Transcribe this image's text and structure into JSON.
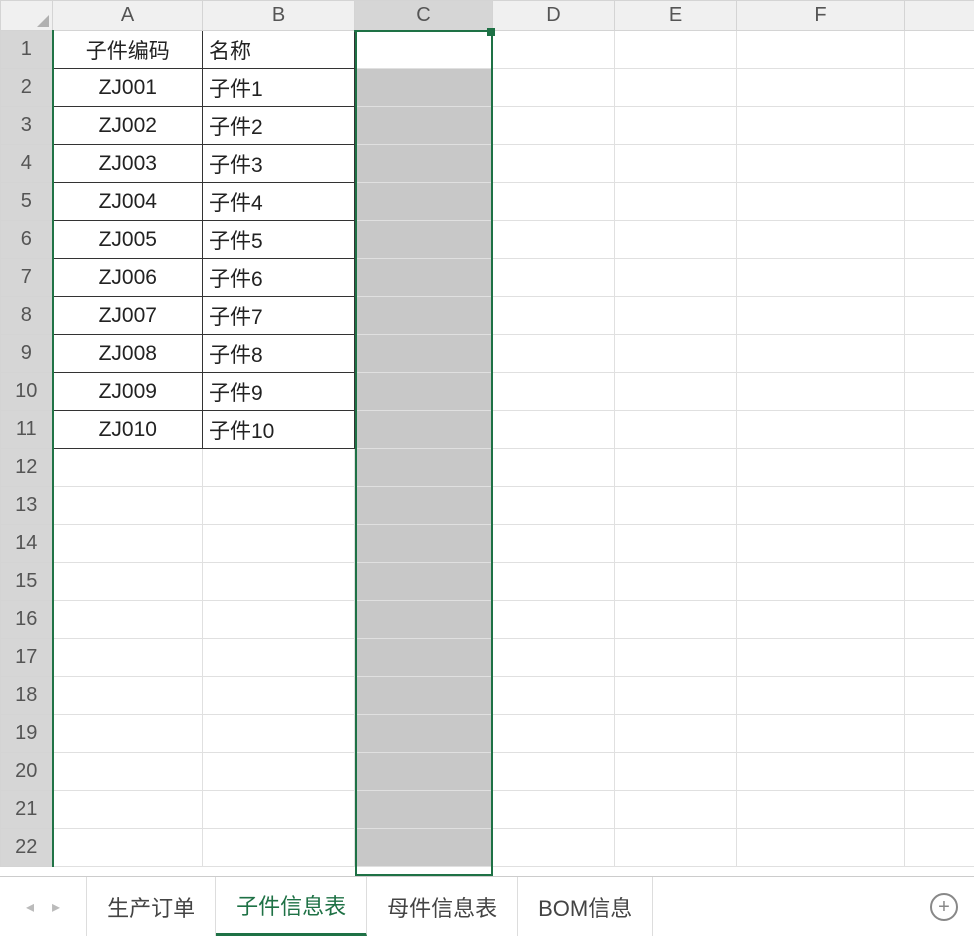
{
  "columns": [
    "A",
    "B",
    "C",
    "D",
    "E",
    "F"
  ],
  "selected_column": "C",
  "row_count": 22,
  "headers": {
    "A": "子件编码",
    "B": "名称"
  },
  "rows": [
    {
      "A": "ZJ001",
      "B": "子件1"
    },
    {
      "A": "ZJ002",
      "B": "子件2"
    },
    {
      "A": "ZJ003",
      "B": "子件3"
    },
    {
      "A": "ZJ004",
      "B": "子件4"
    },
    {
      "A": "ZJ005",
      "B": "子件5"
    },
    {
      "A": "ZJ006",
      "B": "子件6"
    },
    {
      "A": "ZJ007",
      "B": "子件7"
    },
    {
      "A": "ZJ008",
      "B": "子件8"
    },
    {
      "A": "ZJ009",
      "B": "子件9"
    },
    {
      "A": "ZJ010",
      "B": "子件10"
    }
  ],
  "tabs": [
    {
      "label": "生产订单",
      "active": false
    },
    {
      "label": "子件信息表",
      "active": true
    },
    {
      "label": "母件信息表",
      "active": false
    },
    {
      "label": "BOM信息",
      "active": false
    }
  ],
  "nav": {
    "prev_all": "◂",
    "prev": "‹",
    "next": "›",
    "next_all": "▸"
  }
}
